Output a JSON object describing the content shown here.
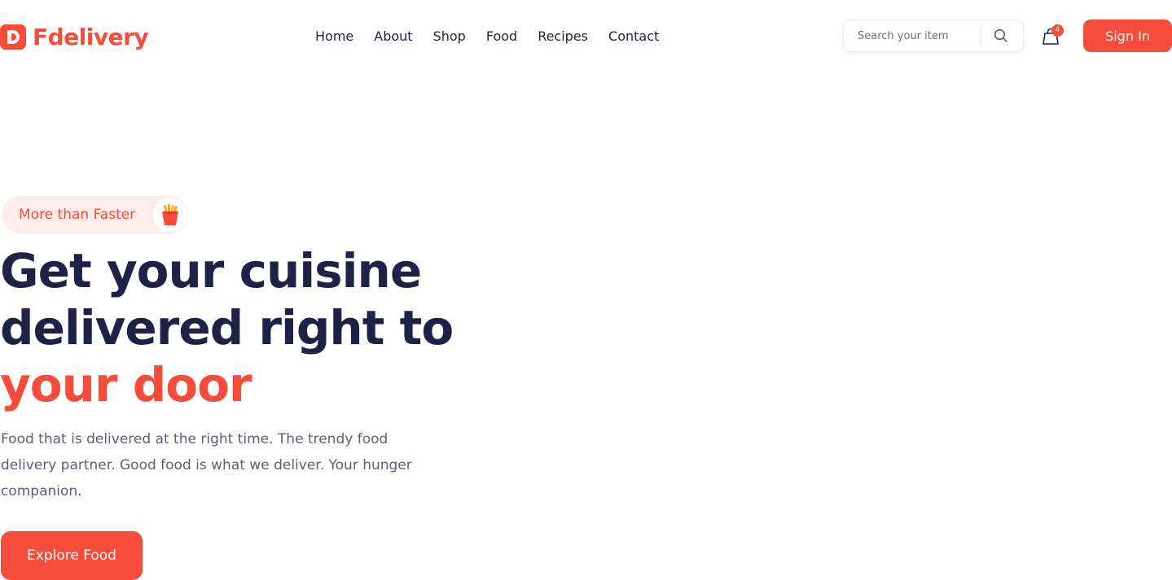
{
  "header": {
    "logo_letter": "D",
    "brand": "Fdelivery",
    "nav": [
      "Home",
      "About",
      "Shop",
      "Food",
      "Recipes",
      "Contact"
    ],
    "search": {
      "placeholder": "Search your item",
      "icon": "search-icon"
    },
    "cart": {
      "icon": "shopping-bag-icon",
      "count": "4"
    },
    "signin_label": "Sign In"
  },
  "hero": {
    "tagline": "More than Faster",
    "tagline_icon": "fries-icon",
    "headline_line1": "Get your cuisine",
    "headline_line2": "delivered right to",
    "headline_accent": "your door",
    "description": "Food that is delivered at the right time. The trendy food delivery partner. Good food is what we deliver. Your hunger companion.",
    "cta_label": "Explore Food"
  },
  "colors": {
    "accent": "#f54c3b",
    "heading": "#1f2146",
    "body_text": "#5d5f72",
    "tagline_bg": "#fdeceb"
  }
}
